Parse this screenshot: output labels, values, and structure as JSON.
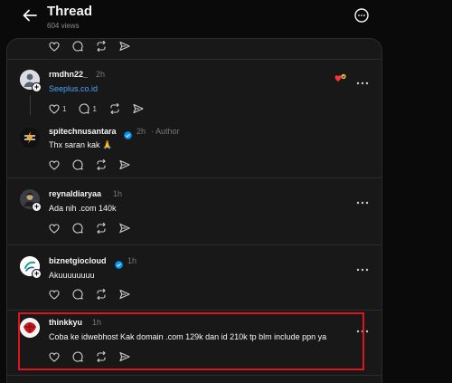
{
  "header": {
    "title": "Thread",
    "views": "604 views"
  },
  "posts": [
    {
      "username": "rmdhn22_",
      "time": "2h",
      "text": "Seeplus.co.id",
      "likes": "1",
      "replies": "1"
    },
    {
      "username": "spitechnusantara",
      "time": "2h",
      "author_label": "· Author",
      "text": "Thx saran kak 🙏"
    },
    {
      "username": "reynaldiaryaa",
      "time": "1h",
      "text": "Ada nih .com 140k"
    },
    {
      "username": "biznetgiocloud",
      "time": "1h",
      "text": "Akuuuuuuuu"
    },
    {
      "username": "thinkkyu",
      "time": "1h",
      "text": "Coba ke idwebhost Kak domain .com 129k dan id 210k tp blm include ppn ya"
    }
  ],
  "colors": {
    "background": "#0a0a0a",
    "panel": "#181818",
    "link": "#4aa3ff",
    "verified": "#0095f6",
    "highlight": "#e0141b"
  }
}
